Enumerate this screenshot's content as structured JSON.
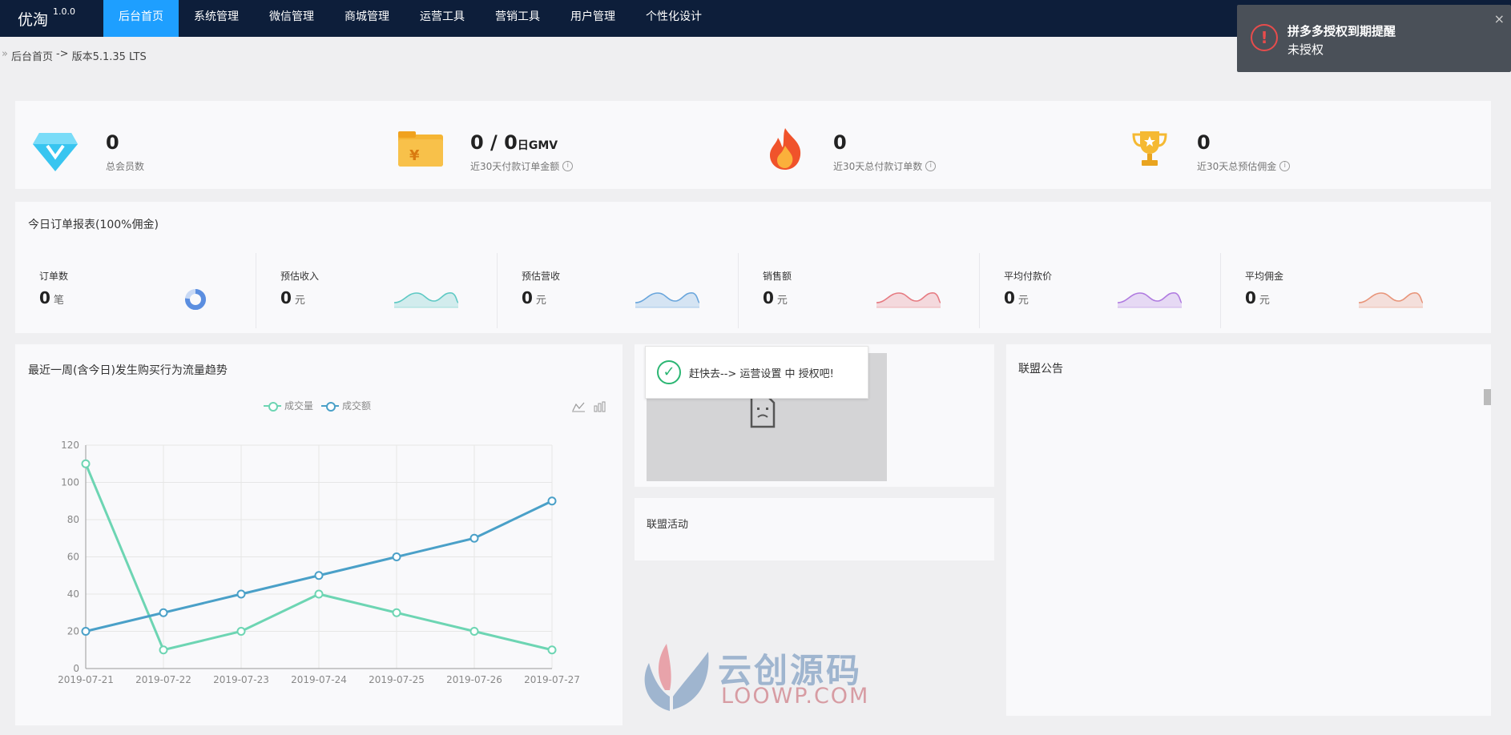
{
  "header": {
    "brand": "优淘",
    "version": "1.0.0",
    "nav": [
      {
        "label": "后台首页",
        "active": true
      },
      {
        "label": "系统管理"
      },
      {
        "label": "微信管理"
      },
      {
        "label": "商城管理"
      },
      {
        "label": "运营工具"
      },
      {
        "label": "营销工具"
      },
      {
        "label": "用户管理"
      },
      {
        "label": "个性化设计"
      }
    ]
  },
  "toast": {
    "title": "拼多多授权到期提醒",
    "message": "未授权",
    "close": "×"
  },
  "breadcrumb": {
    "home": "后台首页",
    "sep": "->",
    "version": "版本5.1.35 LTS"
  },
  "stats": [
    {
      "value": "0",
      "label": "总会员数",
      "icon": "diamond-icon",
      "info": false
    },
    {
      "value": "0 / 0",
      "unit": "日GMV",
      "label": "近30天付款订单金额",
      "icon": "folder-icon",
      "info": true
    },
    {
      "value": "0",
      "label": "近30天总付款订单数",
      "icon": "fire-icon",
      "info": true
    },
    {
      "value": "0",
      "label": "近30天总预估佣金",
      "icon": "trophy-icon",
      "info": true
    }
  ],
  "report": {
    "title": "今日订单报表(100%佣金)",
    "cells": [
      {
        "label": "订单数",
        "value": "0",
        "unit": "笔",
        "color": "#5b8ee0"
      },
      {
        "label": "预估收入",
        "value": "0",
        "unit": "元",
        "color": "#5ec9c4"
      },
      {
        "label": "预估营收",
        "value": "0",
        "unit": "元",
        "color": "#6aa6dc"
      },
      {
        "label": "销售额",
        "value": "0",
        "unit": "元",
        "color": "#e67b82"
      },
      {
        "label": "平均付款价",
        "value": "0",
        "unit": "元",
        "color": "#b07be0"
      },
      {
        "label": "平均佣金",
        "value": "0",
        "unit": "元",
        "color": "#e8957a"
      }
    ]
  },
  "trend": {
    "title": "最近一周(含今日)发生购买行为流量趋势",
    "legend": [
      "成交量",
      "成交额"
    ]
  },
  "chart_data": {
    "type": "line",
    "x": [
      "2019-07-21",
      "2019-07-22",
      "2019-07-23",
      "2019-07-24",
      "2019-07-25",
      "2019-07-26",
      "2019-07-27"
    ],
    "series": [
      {
        "name": "成交量",
        "values": [
          110,
          10,
          20,
          40,
          30,
          20,
          10
        ],
        "color": "#6dd5b3"
      },
      {
        "name": "成交额",
        "values": [
          20,
          30,
          40,
          50,
          60,
          70,
          90
        ],
        "color": "#4aa0c8"
      }
    ],
    "ylim": [
      0,
      120
    ],
    "yticks": [
      0,
      20,
      40,
      60,
      80,
      100,
      120
    ],
    "grid": true,
    "legend_position": "top"
  },
  "tip": {
    "text": "赶快去--> 运营设置 中 授权吧!"
  },
  "activity": {
    "title": "联盟活动"
  },
  "notice": {
    "title": "联盟公告"
  },
  "watermark": {
    "text": "云创源码",
    "sub": "LOOWP.COM"
  }
}
